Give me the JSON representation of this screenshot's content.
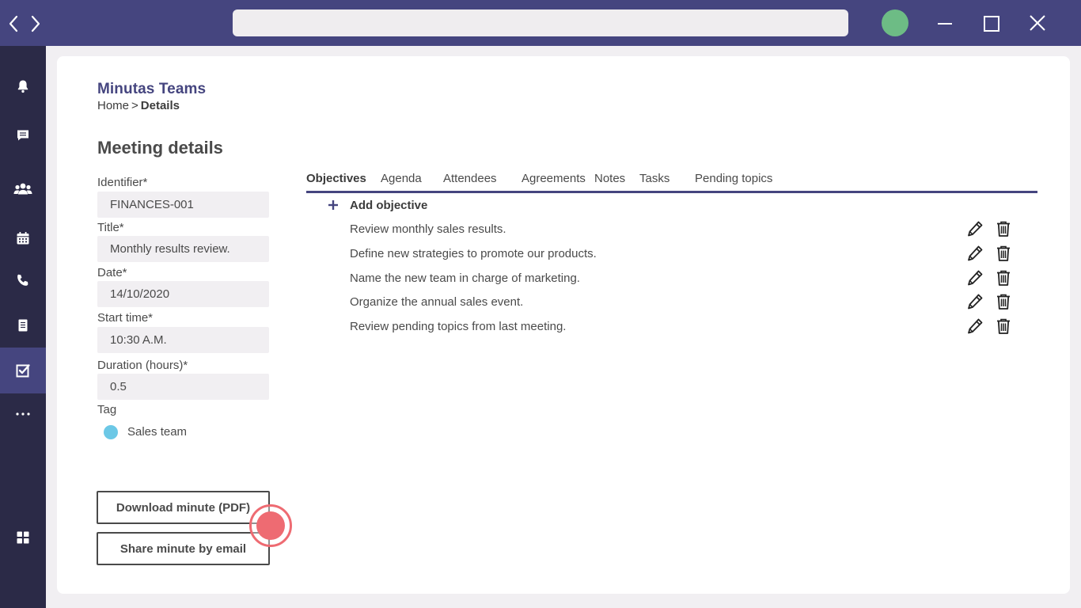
{
  "window": {
    "address_bar_value": "",
    "avatar_color": "#6dbc85",
    "controls": [
      "minimize-icon",
      "maximize-icon",
      "close-icon"
    ]
  },
  "sidebar": {
    "items": [
      {
        "name": "notifications",
        "icon": "bell-icon"
      },
      {
        "name": "chat",
        "icon": "chat-icon"
      },
      {
        "name": "teams",
        "icon": "users-icon"
      },
      {
        "name": "calendar",
        "icon": "calendar-icon"
      },
      {
        "name": "calls",
        "icon": "phone-icon"
      },
      {
        "name": "files",
        "icon": "document-icon"
      },
      {
        "name": "tasks",
        "icon": "checkbox-icon",
        "active": true
      },
      {
        "name": "more",
        "icon": "ellipsis-icon"
      },
      {
        "name": "apps",
        "icon": "apps-grid-icon"
      }
    ]
  },
  "header": {
    "app_title": "Minutas Teams",
    "breadcrumb": {
      "home": "Home",
      "separator": ">",
      "current": "Details"
    }
  },
  "page_title": "Meeting details",
  "form": {
    "identifier": {
      "label": "Identifier*",
      "value": "FINANCES-001"
    },
    "title": {
      "label": "Title*",
      "value": "Monthly results review."
    },
    "date": {
      "label": "Date*",
      "value": "14/10/2020"
    },
    "start_time": {
      "label": "Start time*",
      "value": "10:30 A.M."
    },
    "duration": {
      "label": "Duration (hours)*",
      "value": "0.5"
    },
    "tag": {
      "label": "Tag",
      "value": "Sales team",
      "color": "#6cc8e6"
    }
  },
  "actions": {
    "download": "Download minute (PDF)",
    "share": "Share minute by email"
  },
  "tabs": [
    {
      "label": "Objectives",
      "active": true
    },
    {
      "label": "Agenda"
    },
    {
      "label": "Attendees"
    },
    {
      "label": "Agreements"
    },
    {
      "label": "Notes"
    },
    {
      "label": "Tasks"
    },
    {
      "label": "Pending topics"
    }
  ],
  "objectives": {
    "add_label": "Add objective",
    "items": [
      "Review monthly sales results.",
      "Define new strategies to promote our products.",
      "Name the new team in charge of marketing.",
      "Organize the annual sales event.",
      "Review pending topics from last meeting."
    ]
  },
  "colors": {
    "accent": "#45457f",
    "sidebar": "#2b2a47",
    "field_background": "#f1eff2",
    "cursor_marker": "#ee6b72"
  }
}
